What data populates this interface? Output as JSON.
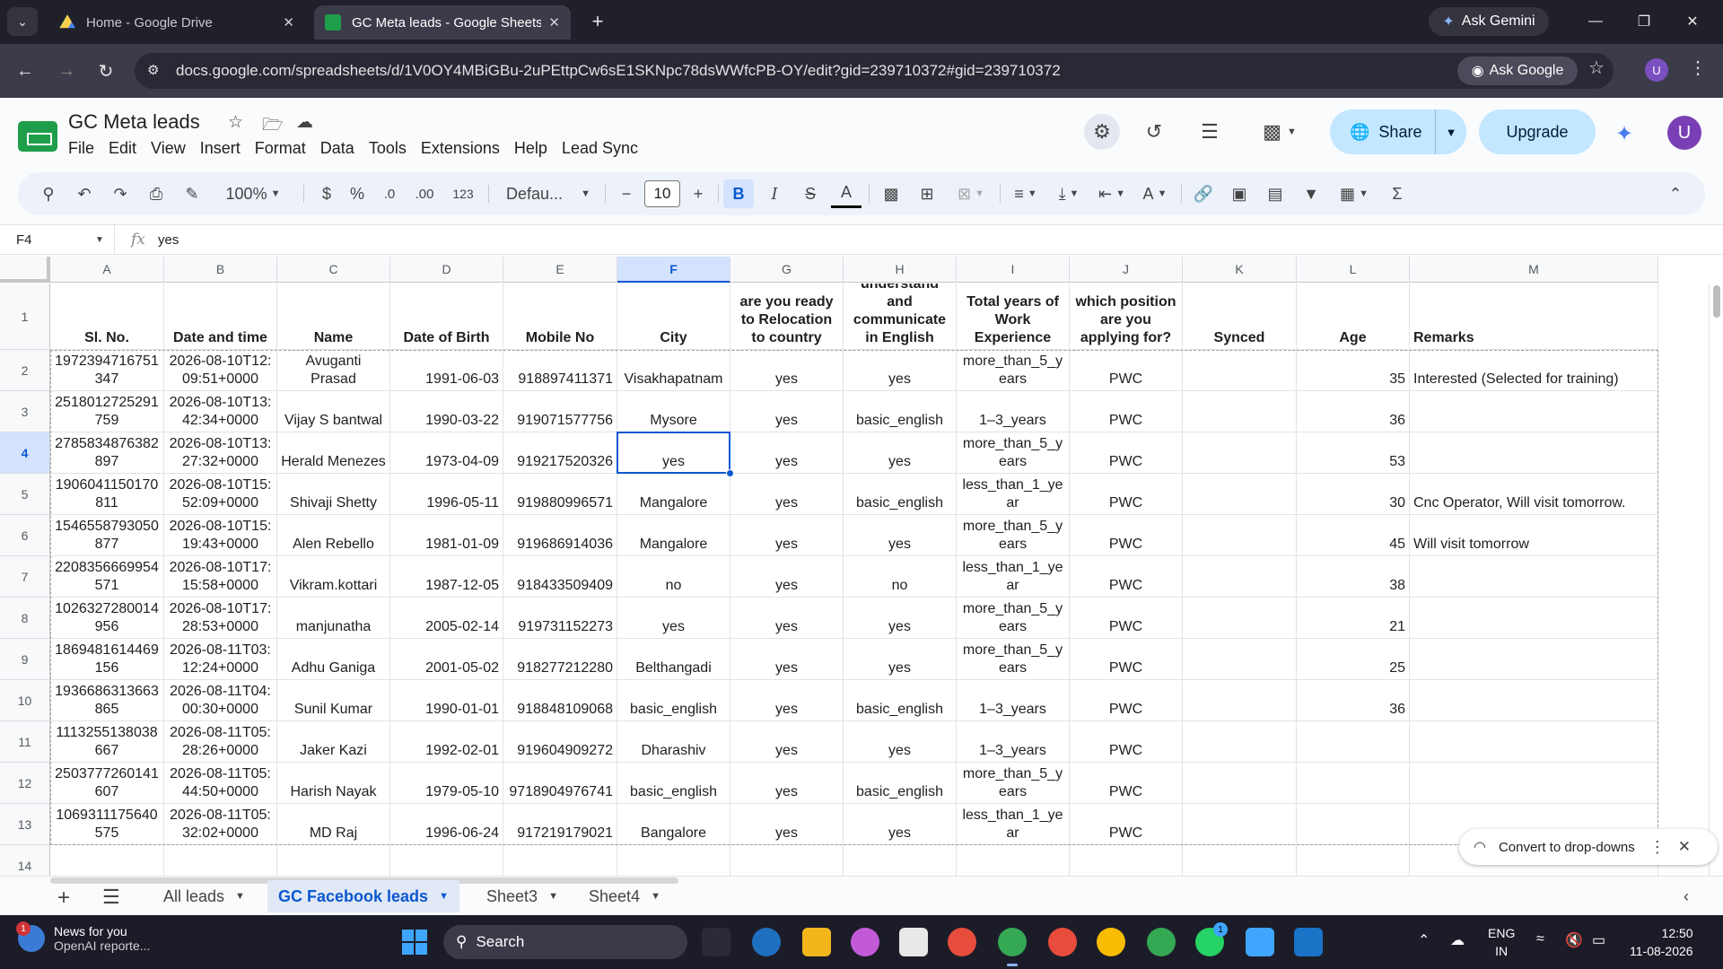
{
  "browser": {
    "tabs": [
      {
        "title": "Home - Google Drive",
        "active": false
      },
      {
        "title": "GC Meta leads - Google Sheets",
        "active": true
      }
    ],
    "gemini_label": "Ask Gemini",
    "url": "docs.google.com/spreadsheets/d/1V0OY4MBiGBu-2uPEttpCw6sE1SKNpc78dsWWfcPB-OY/edit?gid=239710372#gid=239710372",
    "ask_google_label": "Ask Google",
    "profile_initial": "U"
  },
  "doc": {
    "title": "GC Meta leads",
    "menus": [
      "File",
      "Edit",
      "View",
      "Insert",
      "Format",
      "Data",
      "Tools",
      "Extensions",
      "Help",
      "Lead Sync"
    ],
    "share_label": "Share",
    "upgrade_label": "Upgrade",
    "avatar_initial": "U"
  },
  "toolbar": {
    "zoom": "100%",
    "currency": "$",
    "percent": "%",
    "dec_decrease": ".0",
    "dec_increase": ".00",
    "number_format": "123",
    "font": "Defau...",
    "font_size": "10"
  },
  "formula_bar": {
    "cell_ref": "F4",
    "fx": "fx",
    "value": "yes"
  },
  "grid": {
    "columns": [
      "A",
      "B",
      "C",
      "D",
      "E",
      "F",
      "G",
      "H",
      "I",
      "J",
      "K",
      "L",
      "M"
    ],
    "selected_column": "F",
    "selected_row": 4,
    "row_numbers": [
      "1",
      "2",
      "3",
      "4",
      "5",
      "6",
      "7",
      "8",
      "9",
      "10",
      "11",
      "12",
      "13",
      "14"
    ],
    "header_row": [
      "Sl. No.",
      "Date and time",
      "Name",
      "Date of Birth",
      "Mobile No",
      "City",
      "are you ready to Relocation to country",
      "understand and communicate in English",
      "Total years of Work Experience",
      "which position are you applying for?",
      "Synced",
      "Age",
      "Remarks"
    ],
    "rows": [
      [
        "1972394716751347",
        "2026-08-10T12:09:51+0000",
        "Avuganti Prasad",
        "1991-06-03",
        "918897411371",
        "Visakhapatnam",
        "yes",
        "yes",
        "more_than_5_years",
        "PWC",
        "",
        "35",
        "Interested (Selected for training)"
      ],
      [
        "2518012725291759",
        "2026-08-10T13:42:34+0000",
        "Vijay S bantwal",
        "1990-03-22",
        "919071577756",
        "Mysore",
        "yes",
        "basic_english",
        "1–3_years",
        "PWC",
        "",
        "36",
        ""
      ],
      [
        "2785834876382897",
        "2026-08-10T13:27:32+0000",
        "Herald Menezes",
        "1973-04-09",
        "919217520326",
        "yes",
        "yes",
        "yes",
        "more_than_5_years",
        "PWC",
        "",
        "53",
        ""
      ],
      [
        "1906041150170811",
        "2026-08-10T15:52:09+0000",
        "Shivaji Shetty",
        "1996-05-11",
        "919880996571",
        "Mangalore",
        "yes",
        "basic_english",
        "less_than_1_year",
        "PWC",
        "",
        "30",
        "Cnc Operator, Will visit tomorrow."
      ],
      [
        "1546558793050877",
        "2026-08-10T15:19:43+0000",
        "Alen Rebello",
        "1981-01-09",
        "919686914036",
        "Mangalore",
        "yes",
        "yes",
        "more_than_5_years",
        "PWC",
        "",
        "45",
        "Will visit tomorrow"
      ],
      [
        "2208356669954571",
        "2026-08-10T17:15:58+0000",
        "Vikram.kottari",
        "1987-12-05",
        "918433509409",
        "no",
        "yes",
        "no",
        "less_than_1_year",
        "PWC",
        "",
        "38",
        ""
      ],
      [
        "1026327280014956",
        "2026-08-10T17:28:53+0000",
        "manjunatha",
        "2005-02-14",
        "919731152273",
        "yes",
        "yes",
        "yes",
        "more_than_5_years",
        "PWC",
        "",
        "21",
        ""
      ],
      [
        "1869481614469156",
        "2026-08-11T03:12:24+0000",
        "Adhu Ganiga",
        "2001-05-02",
        "918277212280",
        "Belthangadi",
        "yes",
        "yes",
        "more_than_5_years",
        "PWC",
        "",
        "25",
        ""
      ],
      [
        "1936686313663865",
        "2026-08-11T04:00:30+0000",
        "Sunil Kumar",
        "1990-01-01",
        "918848109068",
        "basic_english",
        "yes",
        "basic_english",
        "1–3_years",
        "PWC",
        "",
        "36",
        ""
      ],
      [
        "1113255138038667",
        "2026-08-11T05:28:26+0000",
        "Jaker Kazi",
        "1992-02-01",
        "919604909272",
        "Dharashiv",
        "yes",
        "yes",
        "1–3_years",
        "PWC",
        "",
        "",
        ""
      ],
      [
        "2503777260141607",
        "2026-08-11T05:44:50+0000",
        "Harish Nayak",
        "1979-05-10",
        "9718904976741",
        "basic_english",
        "yes",
        "basic_english",
        "more_than_5_years",
        "PWC",
        "",
        "",
        ""
      ],
      [
        "1069311175640575",
        "2026-08-11T05:32:02+0000",
        "MD Raj",
        "1996-06-24",
        "917219179021",
        "Bangalore",
        "yes",
        "yes",
        "less_than_1_year",
        "PWC",
        "",
        "",
        ""
      ]
    ]
  },
  "toast": {
    "label": "Convert to drop-downs"
  },
  "sheets": {
    "tabs": [
      {
        "label": "All leads",
        "active": false
      },
      {
        "label": "GC Facebook leads",
        "active": true
      },
      {
        "label": "Sheet3",
        "active": false
      },
      {
        "label": "Sheet4",
        "active": false
      }
    ]
  },
  "taskbar": {
    "news_title": "News for you",
    "news_sub": "OpenAI reporte...",
    "news_badge": "1",
    "search_label": "Search",
    "whatsapp_badge": "1",
    "lang_top": "ENG",
    "lang_bottom": "IN",
    "time": "12:50",
    "date": "11-08-2026"
  },
  "colors": {
    "accent": "#0b57d0",
    "share_bg": "#c2e7ff",
    "sheets_green": "#1e9e4a",
    "tab_bar": "#20202b"
  }
}
